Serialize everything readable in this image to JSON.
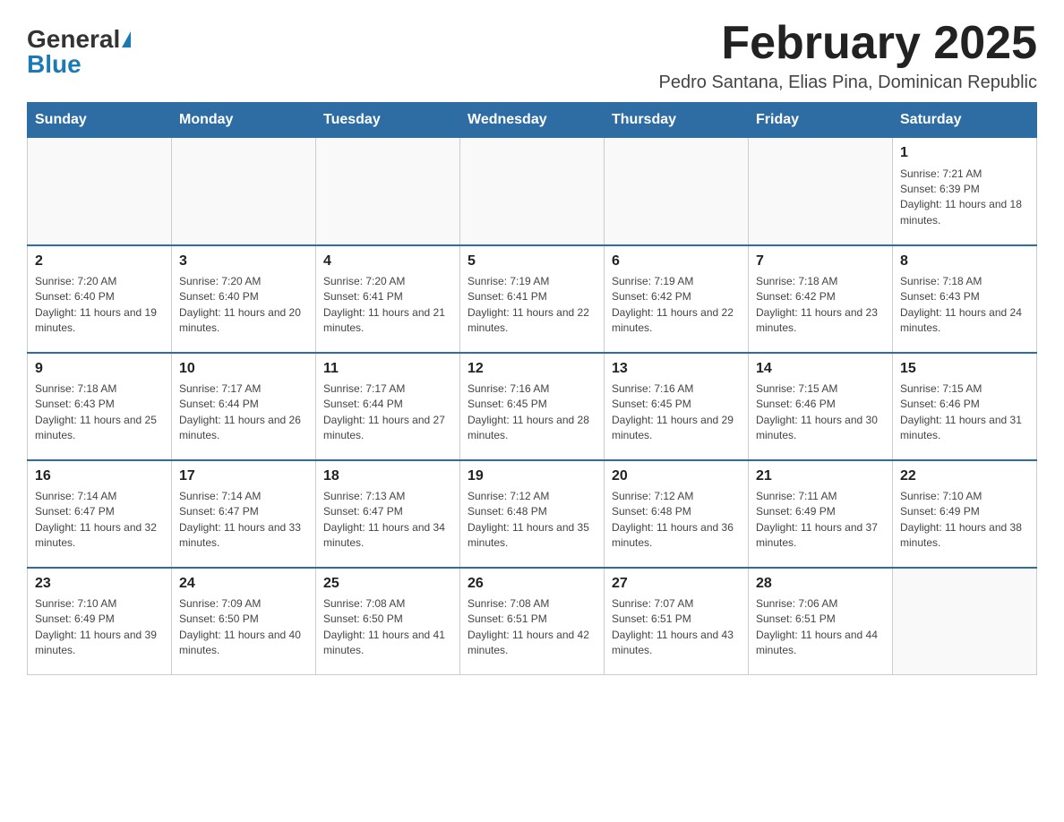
{
  "header": {
    "logo_general": "General",
    "logo_blue": "Blue",
    "title": "February 2025",
    "location": "Pedro Santana, Elias Pina, Dominican Republic"
  },
  "weekdays": [
    "Sunday",
    "Monday",
    "Tuesday",
    "Wednesday",
    "Thursday",
    "Friday",
    "Saturday"
  ],
  "weeks": [
    [
      {
        "day": "",
        "info": ""
      },
      {
        "day": "",
        "info": ""
      },
      {
        "day": "",
        "info": ""
      },
      {
        "day": "",
        "info": ""
      },
      {
        "day": "",
        "info": ""
      },
      {
        "day": "",
        "info": ""
      },
      {
        "day": "1",
        "info": "Sunrise: 7:21 AM\nSunset: 6:39 PM\nDaylight: 11 hours and 18 minutes."
      }
    ],
    [
      {
        "day": "2",
        "info": "Sunrise: 7:20 AM\nSunset: 6:40 PM\nDaylight: 11 hours and 19 minutes."
      },
      {
        "day": "3",
        "info": "Sunrise: 7:20 AM\nSunset: 6:40 PM\nDaylight: 11 hours and 20 minutes."
      },
      {
        "day": "4",
        "info": "Sunrise: 7:20 AM\nSunset: 6:41 PM\nDaylight: 11 hours and 21 minutes."
      },
      {
        "day": "5",
        "info": "Sunrise: 7:19 AM\nSunset: 6:41 PM\nDaylight: 11 hours and 22 minutes."
      },
      {
        "day": "6",
        "info": "Sunrise: 7:19 AM\nSunset: 6:42 PM\nDaylight: 11 hours and 22 minutes."
      },
      {
        "day": "7",
        "info": "Sunrise: 7:18 AM\nSunset: 6:42 PM\nDaylight: 11 hours and 23 minutes."
      },
      {
        "day": "8",
        "info": "Sunrise: 7:18 AM\nSunset: 6:43 PM\nDaylight: 11 hours and 24 minutes."
      }
    ],
    [
      {
        "day": "9",
        "info": "Sunrise: 7:18 AM\nSunset: 6:43 PM\nDaylight: 11 hours and 25 minutes."
      },
      {
        "day": "10",
        "info": "Sunrise: 7:17 AM\nSunset: 6:44 PM\nDaylight: 11 hours and 26 minutes."
      },
      {
        "day": "11",
        "info": "Sunrise: 7:17 AM\nSunset: 6:44 PM\nDaylight: 11 hours and 27 minutes."
      },
      {
        "day": "12",
        "info": "Sunrise: 7:16 AM\nSunset: 6:45 PM\nDaylight: 11 hours and 28 minutes."
      },
      {
        "day": "13",
        "info": "Sunrise: 7:16 AM\nSunset: 6:45 PM\nDaylight: 11 hours and 29 minutes."
      },
      {
        "day": "14",
        "info": "Sunrise: 7:15 AM\nSunset: 6:46 PM\nDaylight: 11 hours and 30 minutes."
      },
      {
        "day": "15",
        "info": "Sunrise: 7:15 AM\nSunset: 6:46 PM\nDaylight: 11 hours and 31 minutes."
      }
    ],
    [
      {
        "day": "16",
        "info": "Sunrise: 7:14 AM\nSunset: 6:47 PM\nDaylight: 11 hours and 32 minutes."
      },
      {
        "day": "17",
        "info": "Sunrise: 7:14 AM\nSunset: 6:47 PM\nDaylight: 11 hours and 33 minutes."
      },
      {
        "day": "18",
        "info": "Sunrise: 7:13 AM\nSunset: 6:47 PM\nDaylight: 11 hours and 34 minutes."
      },
      {
        "day": "19",
        "info": "Sunrise: 7:12 AM\nSunset: 6:48 PM\nDaylight: 11 hours and 35 minutes."
      },
      {
        "day": "20",
        "info": "Sunrise: 7:12 AM\nSunset: 6:48 PM\nDaylight: 11 hours and 36 minutes."
      },
      {
        "day": "21",
        "info": "Sunrise: 7:11 AM\nSunset: 6:49 PM\nDaylight: 11 hours and 37 minutes."
      },
      {
        "day": "22",
        "info": "Sunrise: 7:10 AM\nSunset: 6:49 PM\nDaylight: 11 hours and 38 minutes."
      }
    ],
    [
      {
        "day": "23",
        "info": "Sunrise: 7:10 AM\nSunset: 6:49 PM\nDaylight: 11 hours and 39 minutes."
      },
      {
        "day": "24",
        "info": "Sunrise: 7:09 AM\nSunset: 6:50 PM\nDaylight: 11 hours and 40 minutes."
      },
      {
        "day": "25",
        "info": "Sunrise: 7:08 AM\nSunset: 6:50 PM\nDaylight: 11 hours and 41 minutes."
      },
      {
        "day": "26",
        "info": "Sunrise: 7:08 AM\nSunset: 6:51 PM\nDaylight: 11 hours and 42 minutes."
      },
      {
        "day": "27",
        "info": "Sunrise: 7:07 AM\nSunset: 6:51 PM\nDaylight: 11 hours and 43 minutes."
      },
      {
        "day": "28",
        "info": "Sunrise: 7:06 AM\nSunset: 6:51 PM\nDaylight: 11 hours and 44 minutes."
      },
      {
        "day": "",
        "info": ""
      }
    ]
  ]
}
